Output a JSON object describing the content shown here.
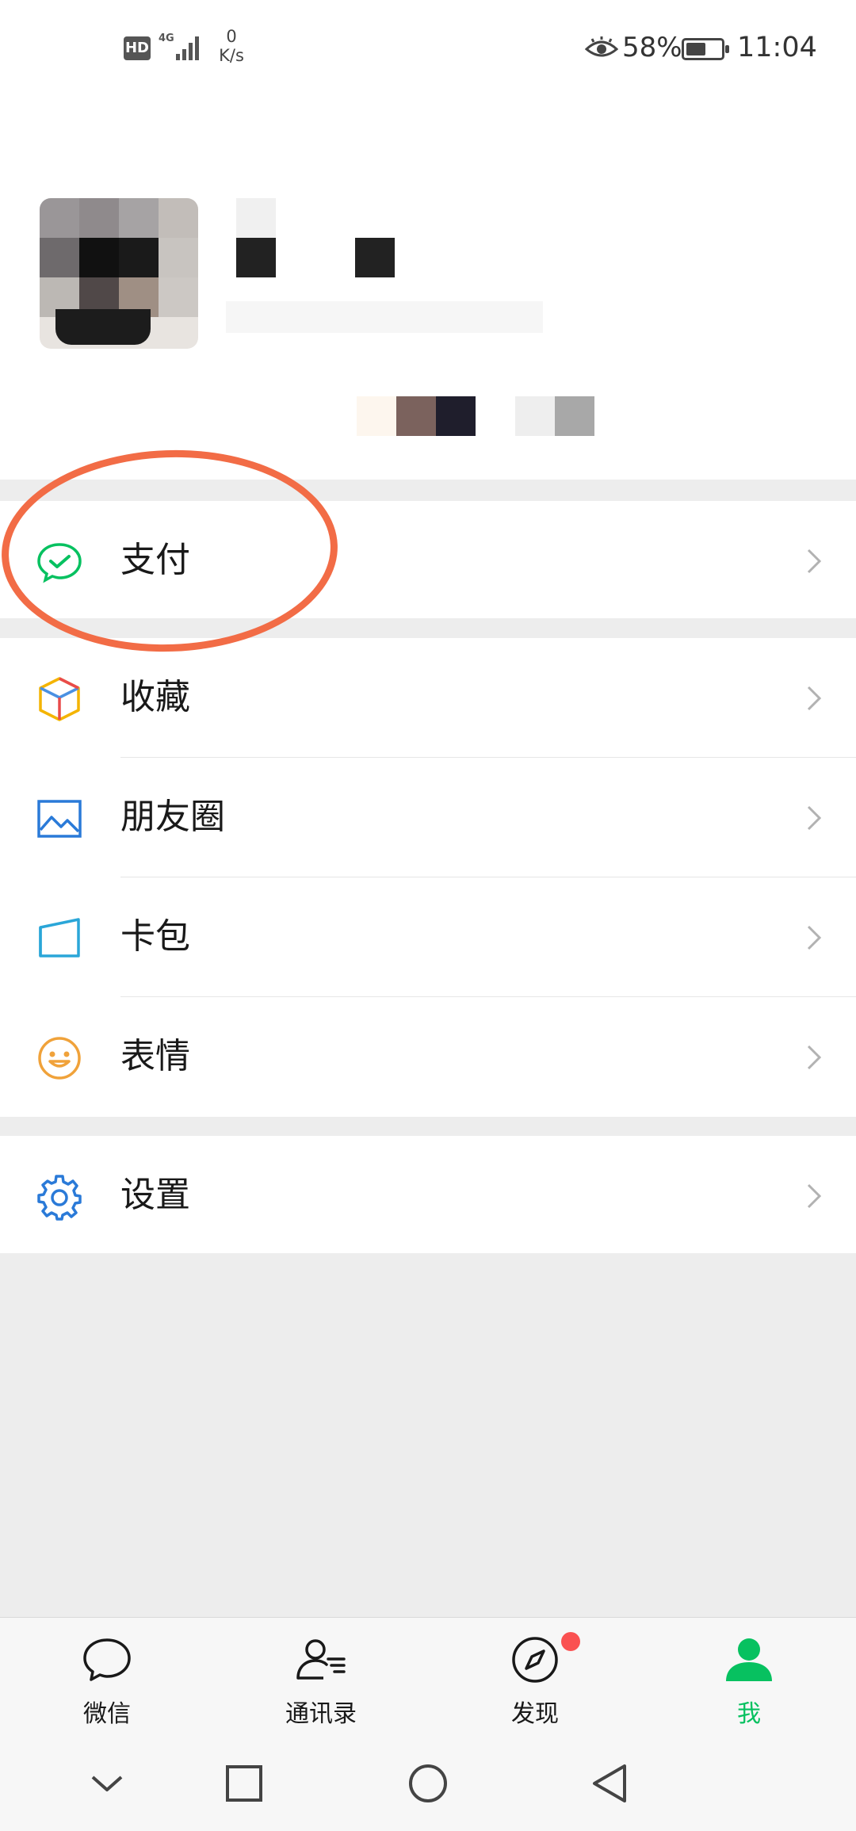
{
  "status_bar": {
    "hd": "HD",
    "network": "4G",
    "speed_value": "0",
    "speed_unit": "K/s",
    "battery_percent": "58%",
    "battery_level": 0.58,
    "time": "11:04"
  },
  "menu": {
    "pay": {
      "label": "支付",
      "icon": "wechat-pay-icon"
    },
    "favorites": {
      "label": "收藏",
      "icon": "cube-icon"
    },
    "moments": {
      "label": "朋友圈",
      "icon": "image-icon"
    },
    "card_pack": {
      "label": "卡包",
      "icon": "card-icon"
    },
    "stickers": {
      "label": "表情",
      "icon": "smiley-icon"
    },
    "settings": {
      "label": "设置",
      "icon": "gear-icon"
    }
  },
  "tab_bar": {
    "tabs": [
      {
        "label": "微信",
        "icon": "chat-bubble-icon",
        "active": false
      },
      {
        "label": "通讯录",
        "icon": "contacts-icon",
        "active": false
      },
      {
        "label": "发现",
        "icon": "compass-icon",
        "active": false,
        "badge_dot": true
      },
      {
        "label": "我",
        "icon": "person-icon",
        "active": true
      }
    ]
  },
  "colors": {
    "accent_green": "#07c160",
    "annotation_orange": "#f26c46",
    "badge_red": "#fa5151",
    "background": "#ededed"
  }
}
